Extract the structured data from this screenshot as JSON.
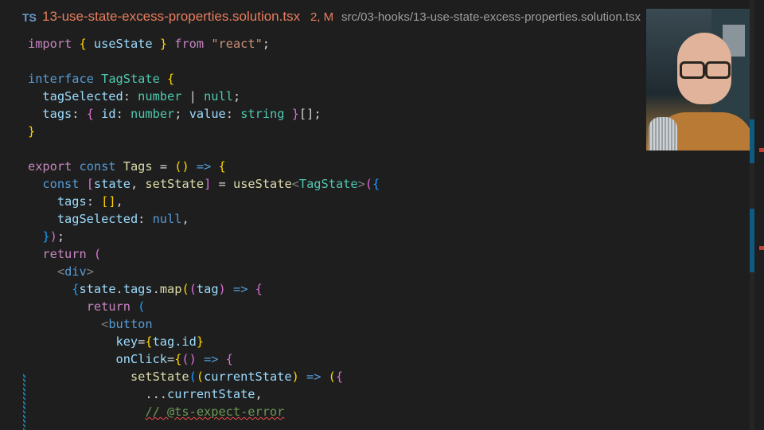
{
  "tab": {
    "lang_badge": "TS",
    "filename": "13-use-state-excess-properties.solution.tsx",
    "status": "2, M",
    "path": "src/03-hooks/13-use-state-excess-properties.solution.tsx"
  },
  "colors": {
    "keyword": "#569cd6",
    "control": "#c586c0",
    "type": "#4ec9b0",
    "function": "#dcdcaa",
    "variable": "#9cdcfe",
    "string": "#ce9178",
    "comment": "#6a9955",
    "error_squiggle": "#f14c4c",
    "tab_modified": "#e87d5e"
  },
  "webcam": {
    "icon": "presenter-webcam-video"
  },
  "code": {
    "l1": {
      "import": "import",
      "b_open": "{",
      "name": "useState",
      "b_close": "}",
      "from": "from",
      "module": "\"react\"",
      "semi": ";"
    },
    "l3": {
      "interface": "interface",
      "name": "TagState",
      "b_open": "{"
    },
    "l4": {
      "prop": "tagSelected",
      "colon": ":",
      "t1": "number",
      "pipe": "|",
      "t2": "null",
      "semi": ";"
    },
    "l5": {
      "prop": "tags",
      "colon": ":",
      "b_open": "{",
      "id": "id",
      "c1": ":",
      "t_id": "number",
      "s1": ";",
      "value": "value",
      "c2": ":",
      "t_value": "string",
      "b_close": "}",
      "arr": "[]",
      "semi": ";"
    },
    "l6": {
      "b_close": "}"
    },
    "l8": {
      "export": "export",
      "const": "const",
      "name": "Tags",
      "eq": "=",
      "parens": "()",
      "arrow": "=>",
      "b_open": "{"
    },
    "l9": {
      "const": "const",
      "b_open": "[",
      "state": "state",
      "comma": ",",
      "setState": "setState",
      "b_close": "]",
      "eq": "=",
      "fn": "useState",
      "lt": "<",
      "type": "TagState",
      "gt": ">",
      "p_open": "(",
      "o_open": "{"
    },
    "l10": {
      "prop": "tags",
      "colon": ":",
      "arr": "[]",
      "comma": ","
    },
    "l11": {
      "prop": "tagSelected",
      "colon": ":",
      "val": "null",
      "comma": ","
    },
    "l12": {
      "o_close": "}",
      "p_close": ")",
      "semi": ";"
    },
    "l13": {
      "return": "return",
      "p_open": "("
    },
    "l14": {
      "lt": "<",
      "tag": "div",
      "gt": ">"
    },
    "l15": {
      "b_open": "{",
      "state": "state",
      "dot1": ".",
      "tags": "tags",
      "dot2": ".",
      "map": "map",
      "p_open": "(",
      "param_open": "(",
      "tag": "tag",
      "param_close": ")",
      "arrow": "=>",
      "c_open": "{"
    },
    "l16": {
      "return": "return",
      "p_open": "("
    },
    "l17": {
      "lt": "<",
      "tag": "button"
    },
    "l18": {
      "attr": "key",
      "eq": "=",
      "b_open": "{",
      "expr": "tag.id",
      "b_close": "}"
    },
    "l19": {
      "attr": "onClick",
      "eq": "=",
      "b_open": "{",
      "parens": "()",
      "arrow": "=>",
      "c_open": "{"
    },
    "l20": {
      "fn": "setState",
      "p_open": "(",
      "param_open": "(",
      "param": "currentState",
      "param_close": ")",
      "arrow": "=>",
      "p2": "(",
      "o_open": "{"
    },
    "l21": {
      "spread": "...",
      "var": "currentState",
      "comma": ","
    },
    "l22": {
      "comment": "// @ts-expect-error"
    }
  }
}
